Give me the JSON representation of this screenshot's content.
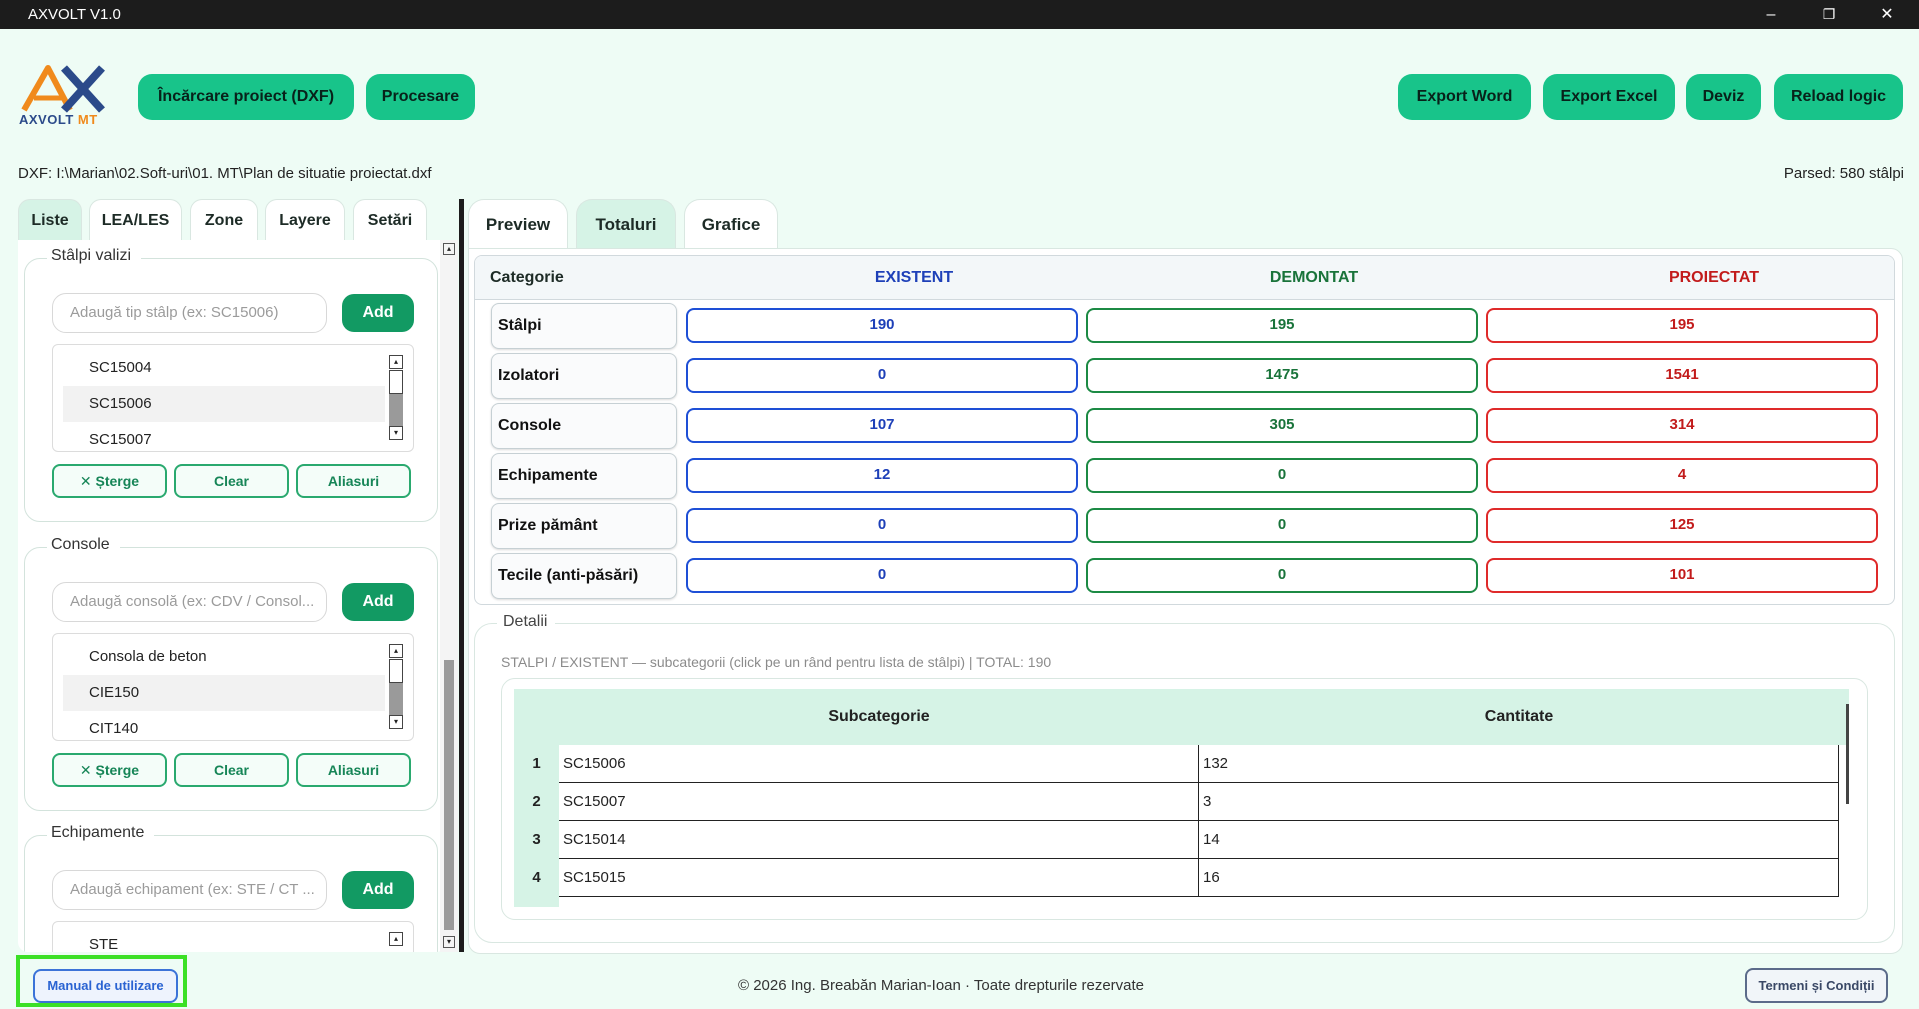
{
  "window": {
    "title": "AXVOLT V1.0",
    "controls": {
      "minimize": "–",
      "restore": "❐",
      "close": "✕"
    }
  },
  "logo": {
    "brand": "AXVOLT",
    "suffix": "MT"
  },
  "toolbar": {
    "load": "Încărcare proiect (DXF)",
    "process": "Procesare",
    "export_word": "Export Word",
    "export_excel": "Export Excel",
    "deviz": "Deviz",
    "reload": "Reload logic"
  },
  "status": {
    "dxf_path": "DXF: I:\\Marian\\02.Soft-uri\\01. MT\\Plan de situatie proiectat.dxf",
    "parsed": "Parsed: 580 stâlpi"
  },
  "left_tabs": [
    "Liste",
    "LEA/LES",
    "Zone",
    "Layere",
    "Setări"
  ],
  "groups": {
    "stalpi": {
      "title": "Stâlpi valizi",
      "placeholder": "Adaugă tip stâlp (ex: SC15006)",
      "add": "Add",
      "items": [
        "SC15004",
        "SC15006",
        "SC15007"
      ],
      "delete": "✕ Șterge",
      "clear": "Clear",
      "aliases": "Aliasuri"
    },
    "console": {
      "title": "Console",
      "placeholder": "Adaugă consolă (ex: CDV / Consol...",
      "add": "Add",
      "items": [
        "Consola de beton",
        "CIE150",
        "CIT140"
      ],
      "delete": "✕ Șterge",
      "clear": "Clear",
      "aliases": "Aliasuri"
    },
    "echipamente": {
      "title": "Echipamente",
      "placeholder": "Adaugă echipament (ex: STE / CT ...",
      "add": "Add",
      "items": [
        "STE"
      ]
    }
  },
  "right_tabs": [
    "Preview",
    "Totaluri",
    "Grafice"
  ],
  "totals": {
    "headers": {
      "category": "Categorie",
      "existent": "EXISTENT",
      "demontat": "DEMONTAT",
      "proiectat": "PROIECTAT"
    },
    "rows": [
      {
        "name": "Stâlpi",
        "existent": "190",
        "demontat": "195",
        "proiectat": "195"
      },
      {
        "name": "Izolatori",
        "existent": "0",
        "demontat": "1475",
        "proiectat": "1541"
      },
      {
        "name": "Console",
        "existent": "107",
        "demontat": "305",
        "proiectat": "314"
      },
      {
        "name": "Echipamente",
        "existent": "12",
        "demontat": "0",
        "proiectat": "4"
      },
      {
        "name": "Prize pământ",
        "existent": "0",
        "demontat": "0",
        "proiectat": "125"
      },
      {
        "name": "Tecile (anti-păsări)",
        "existent": "0",
        "demontat": "0",
        "proiectat": "101"
      }
    ],
    "colors": {
      "existent": "#1e4fd6",
      "demontat": "#1c8a44",
      "proiectat": "#df2a2a"
    }
  },
  "details": {
    "title": "Detalii",
    "subtitle": "STALPI / EXISTENT — subcategorii (click pe un rând pentru lista de stâlpi) | TOTAL: 190",
    "headers": {
      "sub": "Subcategorie",
      "qty": "Cantitate"
    },
    "rows": [
      {
        "i": "1",
        "sub": "SC15006",
        "qty": "132"
      },
      {
        "i": "2",
        "sub": "SC15007",
        "qty": "3"
      },
      {
        "i": "3",
        "sub": "SC15014",
        "qty": "14"
      },
      {
        "i": "4",
        "sub": "SC15015",
        "qty": "16"
      }
    ]
  },
  "footer": {
    "manual": "Manual de utilizare",
    "copyright": "© 2026  Ing. Breabăn Marian-Ioan  ·  Toate drepturile rezervate",
    "terms": "Termeni și Condiții"
  },
  "accent": "#18c48a"
}
